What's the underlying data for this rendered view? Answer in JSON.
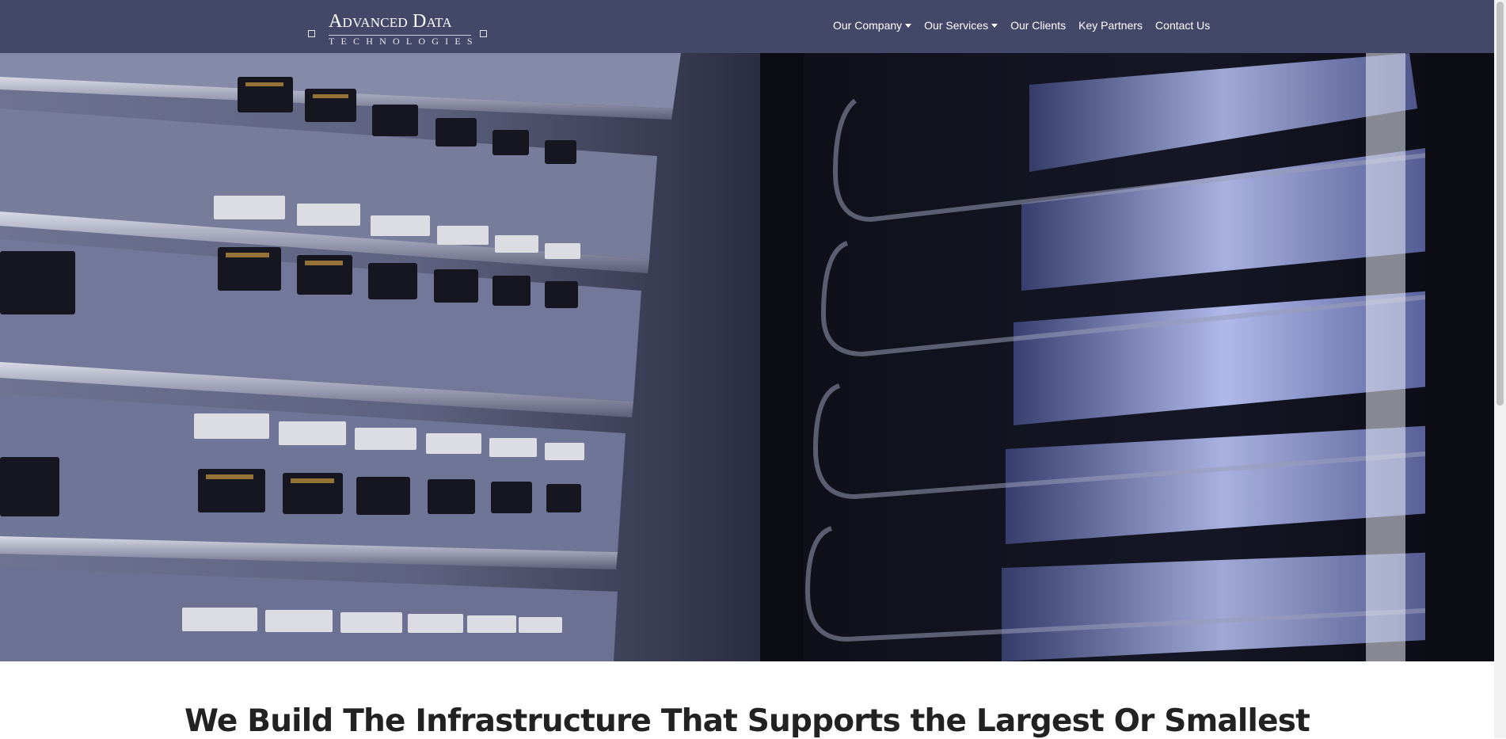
{
  "brand": {
    "name": "Advanced Data",
    "tagline": "TECHNOLOGIES"
  },
  "nav": {
    "items": [
      {
        "label": "Our Company",
        "has_dropdown": true
      },
      {
        "label": "Our Services",
        "has_dropdown": true
      },
      {
        "label": "Our Clients",
        "has_dropdown": false
      },
      {
        "label": "Key Partners",
        "has_dropdown": false
      },
      {
        "label": "Contact Us",
        "has_dropdown": false
      }
    ]
  },
  "hero": {
    "image": "server-rack-photo"
  },
  "main": {
    "heading": "We Build The Infrastructure That Supports the Largest Or Smallest"
  },
  "colors": {
    "navbar_bg": "#434768",
    "nav_text": "#ffffff",
    "heading_text": "#222222"
  },
  "icons": {
    "logo": "logo-bracket-squares",
    "dropdown": "caret-down-icon"
  }
}
